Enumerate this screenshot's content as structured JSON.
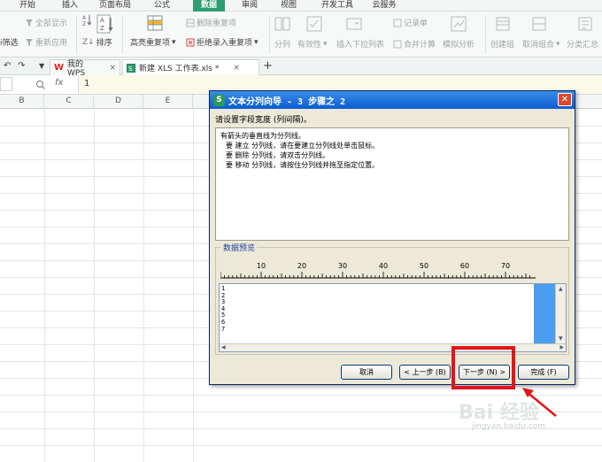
{
  "menu": {
    "tabs": [
      "开始",
      "插入",
      "页面布局",
      "公式",
      "数据",
      "审阅",
      "视图",
      "开发工具",
      "云服务"
    ],
    "active_index": 4,
    "accent_color": "#2e9d71"
  },
  "ribbon": {
    "show_all": "全部显示",
    "reapply": "重新应用",
    "filter_partial": "i筛选",
    "sort": "排序",
    "highlight_duplicates": "高亮重复项",
    "delete_duplicates": "删除重复项",
    "reject_duplicates": "拒绝录入重复项",
    "split_column": "分列",
    "validity": "有效性",
    "dropdown_list": "插入下拉列表",
    "merge_calc": "合并计算",
    "record_form": "记录单",
    "simulate": "模拟分析",
    "create_group": "创建组",
    "ungroup": "取消组合",
    "subtotal": "分类汇总"
  },
  "doc_tabs": {
    "wps_tab": "我的WPS",
    "file_tab": "新建 XLS 工作表.xls *",
    "add_button": "+"
  },
  "formula_bar": {
    "fx_label": "fx",
    "value": "1"
  },
  "columns": [
    "B",
    "C",
    "D",
    "E"
  ],
  "dialog": {
    "title": "文本分列向导 - 3 步骤之 2",
    "close_label": "✕",
    "prompt": "请设置字段宽度 (列间隔)。",
    "info_title": "有箭头的垂直线为分列线。",
    "info_lines": [
      "要 建立 分列线，请在要建立分列线处单击鼠标。",
      "要 删除 分列线，请双击分列线。",
      "要 移动 分列线，请按住分列线并拖至指定位置。"
    ],
    "preview_label": "数据预览",
    "ruler_ticks": [
      "10",
      "20",
      "30",
      "40",
      "50",
      "60",
      "70"
    ],
    "preview_rows": [
      "1",
      "2",
      "3",
      "4",
      "5",
      "6",
      "7"
    ],
    "buttons": {
      "cancel": "取消",
      "back": "< 上一步 (B)",
      "next": "下一步 (N) >",
      "finish": "完成 (F)"
    }
  },
  "watermark": {
    "logo": "Bai 经验",
    "url": "jingyan.baidu.com"
  },
  "highlight_color": "#e3151a"
}
